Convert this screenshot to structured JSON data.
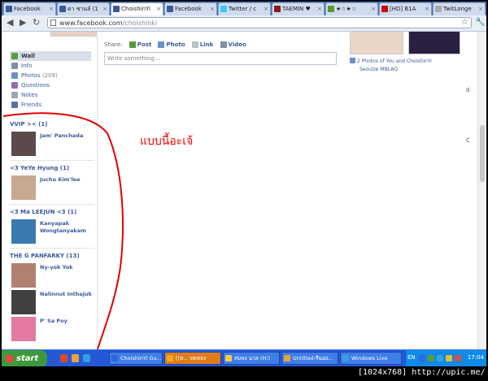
{
  "browser": {
    "tabs": [
      {
        "label": "Facebook",
        "color": "#3b5998"
      },
      {
        "label": "ดา ชานล์ (1",
        "color": "#3b5998"
      },
      {
        "label": "ChoishinYi",
        "color": "#3b5998",
        "active": true
      },
      {
        "label": "Facebook",
        "color": "#3b5998"
      },
      {
        "label": "Twitter / c",
        "color": "#33ccff"
      },
      {
        "label": "TAEMIN ♥",
        "color": "#8b1a1a"
      },
      {
        "label": "★☆★☆",
        "color": "#5a9a2a"
      },
      {
        "label": "[HD] B1A",
        "color": "#cc0000"
      },
      {
        "label": "TwitLonge",
        "color": "#aaaaaa"
      }
    ],
    "url_host": "www.facebook.com",
    "url_path": "/choishinki"
  },
  "nav": [
    {
      "label": "Wall",
      "count": "",
      "icon": "wall-icon",
      "color": "#5b9b3c",
      "active": true
    },
    {
      "label": "Info",
      "count": "",
      "icon": "info-icon",
      "color": "#7f8fa8"
    },
    {
      "label": "Photos",
      "count": "(209)",
      "icon": "photos-icon",
      "color": "#6d8fc6"
    },
    {
      "label": "Questions",
      "count": "",
      "icon": "questions-icon",
      "color": "#8f6fb0"
    },
    {
      "label": "Notes",
      "count": "",
      "icon": "notes-icon",
      "color": "#9aa5b8"
    },
    {
      "label": "Friends",
      "count": "",
      "icon": "friends-icon",
      "color": "#5872a6"
    }
  ],
  "publisher": {
    "share_label": "Share:",
    "post": "Post",
    "photo": "Photo",
    "link": "Link",
    "video": "Video",
    "placeholder": "Write something..."
  },
  "right_column": {
    "caption": "2 Photos of You and ChoishinYi",
    "caption2": "Seoulze  MBLAQ",
    "edge_chars": [
      "d",
      "C"
    ]
  },
  "annotation_text": "แบบนี้อะเจ้",
  "friend_groups": [
    {
      "title": "VVIP >< (1)",
      "friends": [
        {
          "name": "Jam' Panchada",
          "color": "#5a4a4a"
        }
      ]
    },
    {
      "title": "<3 YeYe Hyung (1)",
      "friends": [
        {
          "name": "Juchu Kim'lee",
          "color": "#c8a890"
        }
      ]
    },
    {
      "title": "<3 Ma LEEJUN <3 (1)",
      "friends": [
        {
          "name": "Kanyapak Wongtanyakam",
          "color": "#3a7ab0"
        }
      ]
    },
    {
      "title": "THE G PANFARKY (13)",
      "friends": [
        {
          "name": "Ny-yok Yok",
          "color": "#b08070"
        },
        {
          "name": "Nalinnut Inthajuk",
          "color": "#404040"
        },
        {
          "name": "P' Sa Poy",
          "color": "#e07aa0"
        }
      ]
    }
  ],
  "taskbar": {
    "start": "start",
    "tasks": [
      {
        "label": "ChoishinYi Gu...",
        "color": "#2b6ad8"
      },
      {
        "label": "[(ห... ทดลอง",
        "color": "#f5a623",
        "active": true
      },
      {
        "label": "สมพง นวล (H:)",
        "color": "#f2c94c"
      },
      {
        "label": "Untitled-รีนออ...",
        "color": "#e8a23b"
      },
      {
        "label": "Windows Live",
        "color": "#39a0e0"
      }
    ],
    "lang": "EN",
    "clock": "17:04"
  },
  "watermark": "[1024x768] http://upic.me/"
}
